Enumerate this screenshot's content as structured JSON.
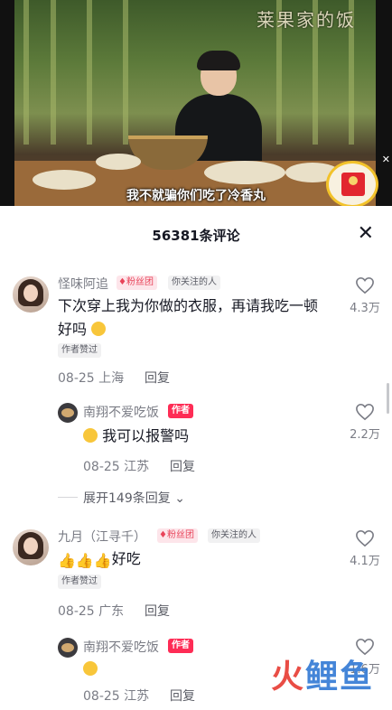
{
  "video": {
    "watermark": "莱果家的饭",
    "subtitle": "我不就骗你们吃了冷香丸"
  },
  "sheet": {
    "title": "56381条评论"
  },
  "comments": [
    {
      "username": "怪味阿追",
      "fan_badge": "粉丝团",
      "follow_badge": "你关注的人",
      "text": "下次穿上我为你做的衣服，再请我吃一顿好吗",
      "author_liked": "作者赞过",
      "date": "08-25",
      "location": "上海",
      "reply_label": "回复",
      "likes": "4.3万",
      "reply": {
        "username": "南翔不爱吃饭",
        "author_badge": "作者",
        "text": "我可以报警吗",
        "date": "08-25",
        "location": "江苏",
        "reply_label": "回复",
        "likes": "2.2万"
      },
      "expand_label": "展开149条回复"
    },
    {
      "username": "九月（江寻千）",
      "fan_badge": "粉丝团",
      "follow_badge": "你关注的人",
      "text": "好吃",
      "author_liked": "作者赞过",
      "date": "08-25",
      "location": "广东",
      "reply_label": "回复",
      "likes": "4.1万",
      "reply": {
        "username": "南翔不爱吃饭",
        "author_badge": "作者",
        "text": "",
        "date": "08-25",
        "location": "江苏",
        "reply_label": "回复",
        "likes": "1.6万"
      }
    }
  ],
  "logo": {
    "part1": "火",
    "part2": "鲤鱼"
  },
  "colors": {
    "accent": "#fe2c55",
    "redpacket": "#e2262f"
  }
}
